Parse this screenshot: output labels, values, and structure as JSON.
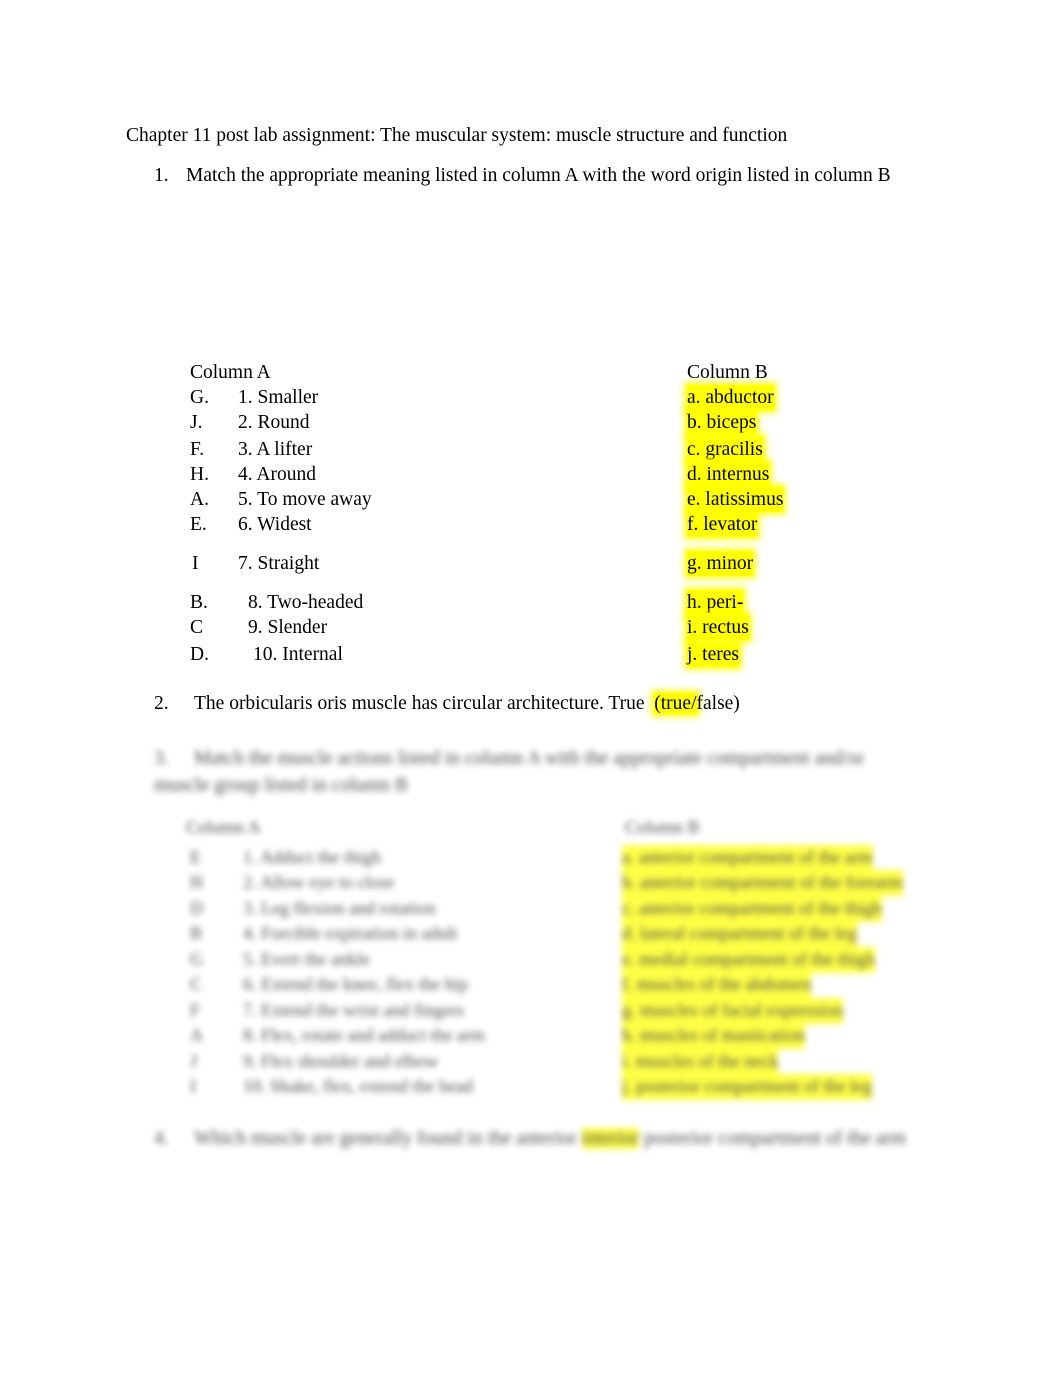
{
  "document": {
    "title": "Chapter 11 post lab assignment: The muscular system: muscle structure and function",
    "question1": {
      "number": "1.",
      "text": "Match the appropriate meaning listed in column A with the word origin listed in column B",
      "column_a_header": "Column A",
      "column_b_header": "Column B",
      "rows": [
        {
          "answer": "G.",
          "item_a": "1. Smaller",
          "item_b": "a. abductor"
        },
        {
          "answer": "J.",
          "item_a": "2. Round",
          "item_b": "b. biceps"
        },
        {
          "answer": "F.",
          "item_a": "3. A lifter",
          "item_b": "c. gracilis"
        },
        {
          "answer": "H.",
          "item_a": "4. Around",
          "item_b": "d. internus"
        },
        {
          "answer": "A.",
          "item_a": "5. To move away",
          "item_b": "e. latissimus"
        },
        {
          "answer": "E.",
          "item_a": "6. Widest",
          "item_b": "f. levator"
        },
        {
          "answer": "I",
          "item_a": "7. Straight",
          "item_b": "g. minor"
        },
        {
          "answer": "B.",
          "item_a": "8. Two-headed",
          "item_b": "h. peri-"
        },
        {
          "answer": "C",
          "item_a": "9. Slender",
          "item_b": "i. rectus"
        },
        {
          "answer": "D.",
          "item_a": "10. Internal",
          "item_b": "j. teres"
        }
      ]
    },
    "question2": {
      "number": "2.",
      "text": "The orbicularis oris muscle has circular architecture. True",
      "choice_highlight": "(true/",
      "choice_rest": "false)"
    },
    "question3": {
      "number": "3.",
      "text": "Match the muscle actions listed in column A with the appropriate compartment and/or muscle group listed in column B",
      "column_a_header": "Column A",
      "column_b_header": "Column B",
      "rows": [
        {
          "answer": "E",
          "item_a": "1. Adduct the thigh",
          "item_b": "a. anterior compartment of the arm"
        },
        {
          "answer": "H",
          "item_a": "2. Allow eye to close",
          "item_b": "b. anterior compartment of the forearm"
        },
        {
          "answer": "D",
          "item_a": "3. Leg flexion and rotation",
          "item_b": "c. anterior compartment of the thigh"
        },
        {
          "answer": "B",
          "item_a": "4. Forcible expiration in adult",
          "item_b": "d. lateral compartment of the leg"
        },
        {
          "answer": "G",
          "item_a": "5. Evert the ankle",
          "item_b": "e. medial compartment of the thigh"
        },
        {
          "answer": "C",
          "item_a": "6. Extend the knee, flex the hip",
          "item_b": "f. muscles of the abdomen"
        },
        {
          "answer": "F",
          "item_a": "7. Extend the wrist and fingers",
          "item_b": "g. muscles of facial expression"
        },
        {
          "answer": "A",
          "item_a": "8. Flex, rotate and adduct the arm",
          "item_b": "h. muscles of mastication"
        },
        {
          "answer": "J",
          "item_a": "9. Flex shoulder and elbow",
          "item_b": "i. muscles of the neck"
        },
        {
          "answer": "I",
          "item_a": "10. Shake, flex, extend the head",
          "item_b": "j. posterior compartment of the leg"
        }
      ]
    },
    "question4": {
      "number": "4.",
      "text_before": "Which muscle are generally found in the anterior",
      "highlight": "interior",
      "text_after": "posterior compartment of the arm"
    }
  }
}
